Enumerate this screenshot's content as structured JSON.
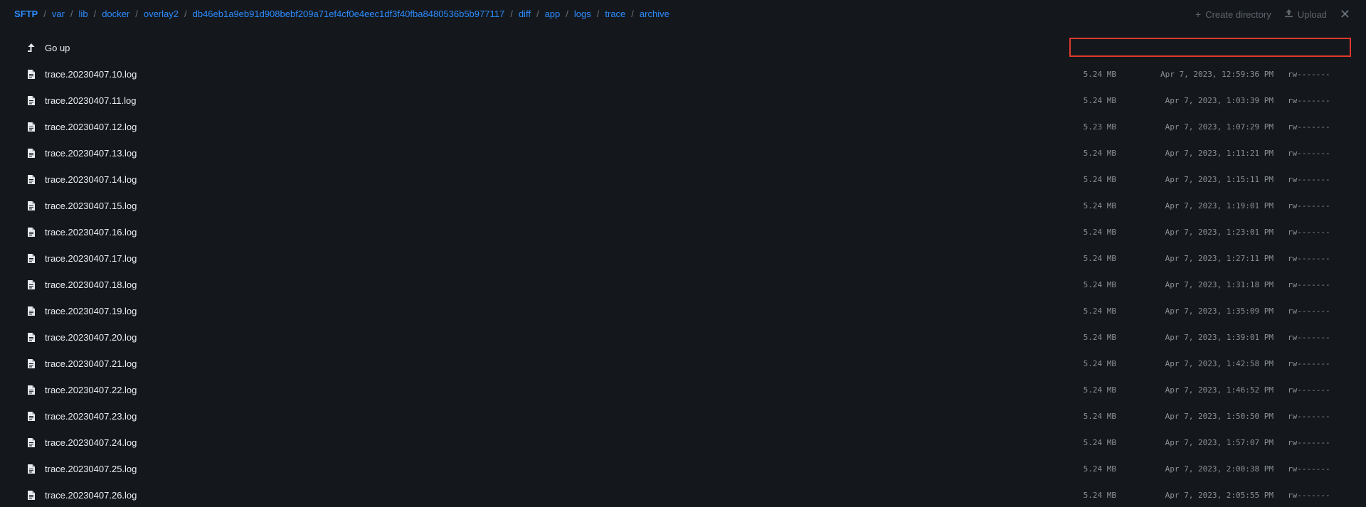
{
  "breadcrumb": {
    "root": "SFTP",
    "parts": [
      "var",
      "lib",
      "docker",
      "overlay2",
      "db46eb1a9eb91d908bebf209a71ef4cf0e4eec1df3f40fba8480536b5b977117",
      "diff",
      "app",
      "logs",
      "trace",
      "archive"
    ]
  },
  "header": {
    "create_directory": "Create directory",
    "upload": "Upload"
  },
  "go_up": "Go up",
  "files": [
    {
      "name": "trace.20230407.10.log",
      "size": "5.24 MB",
      "date": "Apr 7, 2023, 12:59:36 PM",
      "perm": "rw-------"
    },
    {
      "name": "trace.20230407.11.log",
      "size": "5.24 MB",
      "date": "Apr 7, 2023, 1:03:39 PM",
      "perm": "rw-------"
    },
    {
      "name": "trace.20230407.12.log",
      "size": "5.23 MB",
      "date": "Apr 7, 2023, 1:07:29 PM",
      "perm": "rw-------"
    },
    {
      "name": "trace.20230407.13.log",
      "size": "5.24 MB",
      "date": "Apr 7, 2023, 1:11:21 PM",
      "perm": "rw-------"
    },
    {
      "name": "trace.20230407.14.log",
      "size": "5.24 MB",
      "date": "Apr 7, 2023, 1:15:11 PM",
      "perm": "rw-------"
    },
    {
      "name": "trace.20230407.15.log",
      "size": "5.24 MB",
      "date": "Apr 7, 2023, 1:19:01 PM",
      "perm": "rw-------"
    },
    {
      "name": "trace.20230407.16.log",
      "size": "5.24 MB",
      "date": "Apr 7, 2023, 1:23:01 PM",
      "perm": "rw-------"
    },
    {
      "name": "trace.20230407.17.log",
      "size": "5.24 MB",
      "date": "Apr 7, 2023, 1:27:11 PM",
      "perm": "rw-------"
    },
    {
      "name": "trace.20230407.18.log",
      "size": "5.24 MB",
      "date": "Apr 7, 2023, 1:31:18 PM",
      "perm": "rw-------"
    },
    {
      "name": "trace.20230407.19.log",
      "size": "5.24 MB",
      "date": "Apr 7, 2023, 1:35:09 PM",
      "perm": "rw-------"
    },
    {
      "name": "trace.20230407.20.log",
      "size": "5.24 MB",
      "date": "Apr 7, 2023, 1:39:01 PM",
      "perm": "rw-------"
    },
    {
      "name": "trace.20230407.21.log",
      "size": "5.24 MB",
      "date": "Apr 7, 2023, 1:42:58 PM",
      "perm": "rw-------"
    },
    {
      "name": "trace.20230407.22.log",
      "size": "5.24 MB",
      "date": "Apr 7, 2023, 1:46:52 PM",
      "perm": "rw-------"
    },
    {
      "name": "trace.20230407.23.log",
      "size": "5.24 MB",
      "date": "Apr 7, 2023, 1:50:50 PM",
      "perm": "rw-------"
    },
    {
      "name": "trace.20230407.24.log",
      "size": "5.24 MB",
      "date": "Apr 7, 2023, 1:57:07 PM",
      "perm": "rw-------"
    },
    {
      "name": "trace.20230407.25.log",
      "size": "5.24 MB",
      "date": "Apr 7, 2023, 2:00:38 PM",
      "perm": "rw-------"
    },
    {
      "name": "trace.20230407.26.log",
      "size": "5.24 MB",
      "date": "Apr 7, 2023, 2:05:55 PM",
      "perm": "rw-------"
    }
  ]
}
